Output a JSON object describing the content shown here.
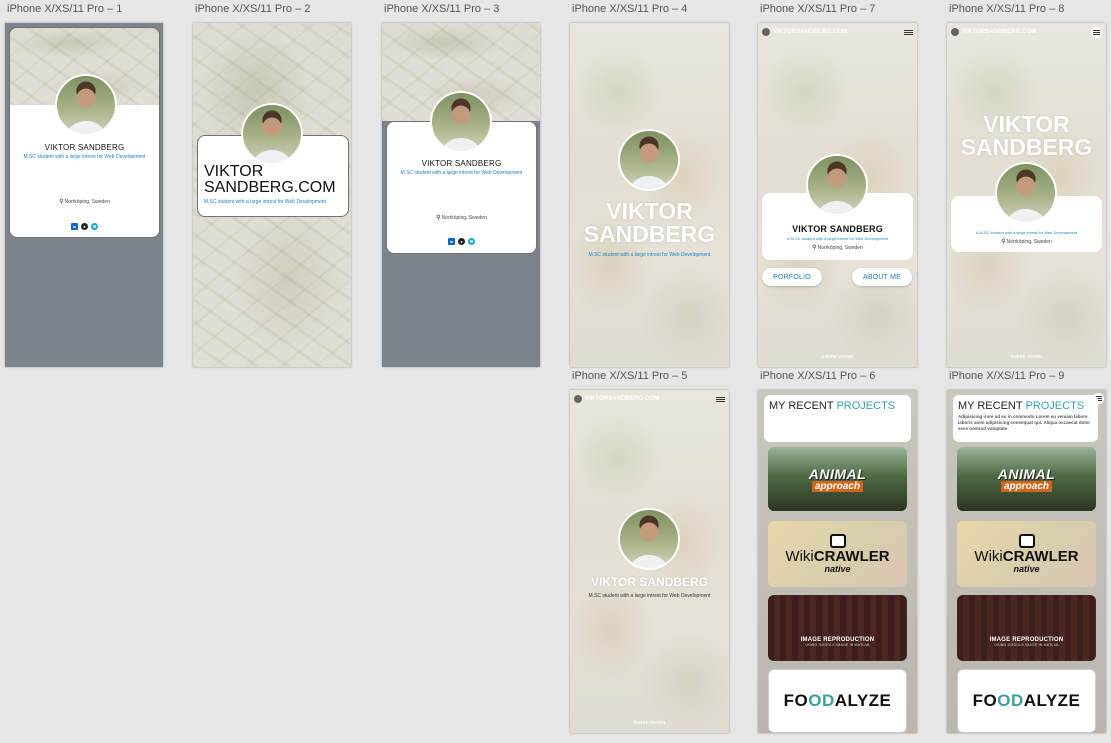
{
  "artboards": [
    {
      "label": "iPhone X/XS/11 Pro – 1"
    },
    {
      "label": "iPhone X/XS/11 Pro – 2"
    },
    {
      "label": "iPhone X/XS/11 Pro – 3"
    },
    {
      "label": "iPhone X/XS/11 Pro – 4"
    },
    {
      "label": "iPhone X/XS/11 Pro – 7"
    },
    {
      "label": "iPhone X/XS/11 Pro – 8"
    },
    {
      "label": "iPhone X/XS/11 Pro – 5"
    },
    {
      "label": "iPhone X/XS/11 Pro – 6"
    },
    {
      "label": "iPhone X/XS/11 Pro – 9"
    }
  ],
  "profile": {
    "name_upper": "VIKTOR SANDBERG",
    "first": "VIKTOR",
    "last": "SANDBERG",
    "domain_line1": "VIKTOR",
    "domain_line2": "SANDBERG.COM",
    "tagline": "M.SC student with a large intrest for Web Development",
    "tagline_short": "A M.SC student with a large intrest for Web Development",
    "location": "Norrköping, Sweden"
  },
  "nav": {
    "site_name": "VIKTORSANDBERG.COM",
    "portfolio_button": "PORFOLIO",
    "about_button": "ABOUT ME",
    "swipe_hint": "SWIPE DOWN"
  },
  "projects": {
    "heading_prefix": "MY RECENT ",
    "heading_accent": "PROJECTS",
    "intro": "Adipisicing irure ad eu in commodo Lorem eu veniam labore laboris anim adipisicing consequat qui. Aliqua occaecat dolor esse nostrud voluptate",
    "animal_line1": "ANIMAL",
    "animal_line2": "approach",
    "wiki_prefix": "Wiki",
    "wiki_bold": "CRAWLER",
    "wiki_sub": "native",
    "image_title": "IMAGE REPRODUCTION",
    "image_sub": "USING GOOGLE IMAGE IN MATLAB",
    "food_a": "FO",
    "food_b": "OD",
    "food_c": "ALYZE"
  },
  "colors": {
    "accent_blue": "#1a7fc0",
    "accent_teal": "#3a9fb5",
    "artboard_gray": "#7d838a"
  }
}
